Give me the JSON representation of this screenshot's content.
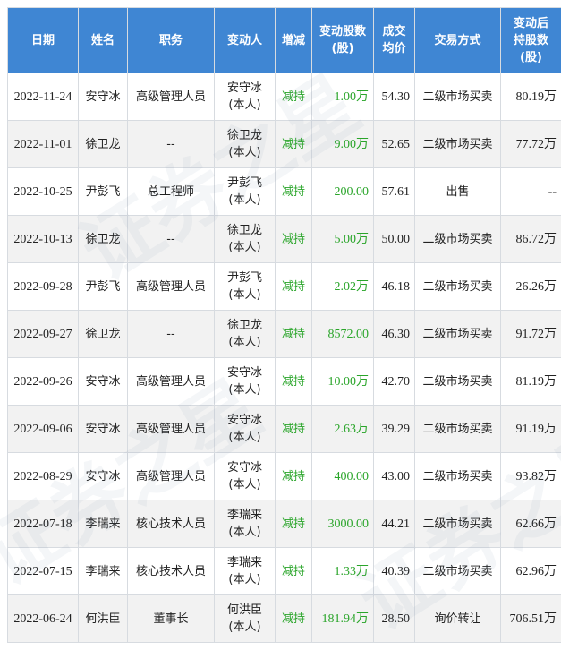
{
  "headers": [
    "日期",
    "姓名",
    "职务",
    "变动人",
    "增减",
    "变动股数\n(股)",
    "成交\n均价",
    "交易方式",
    "变动后\n持股数\n(股)"
  ],
  "rows": [
    {
      "date": "2022-11-24",
      "name": "安守冰",
      "title": "高级管理人员",
      "changer": "安守冰\n(本人)",
      "direction": "减持",
      "shares": "1.00万",
      "price": "54.30",
      "method": "二级市场买卖",
      "after": "80.19万"
    },
    {
      "date": "2022-11-01",
      "name": "徐卫龙",
      "title": "--",
      "changer": "徐卫龙\n(本人)",
      "direction": "减持",
      "shares": "9.00万",
      "price": "52.65",
      "method": "二级市场买卖",
      "after": "77.72万"
    },
    {
      "date": "2022-10-25",
      "name": "尹彭飞",
      "title": "总工程师",
      "changer": "尹彭飞\n(本人)",
      "direction": "减持",
      "shares": "200.00",
      "price": "57.61",
      "method": "出售",
      "after": "--"
    },
    {
      "date": "2022-10-13",
      "name": "徐卫龙",
      "title": "--",
      "changer": "徐卫龙\n(本人)",
      "direction": "减持",
      "shares": "5.00万",
      "price": "50.00",
      "method": "二级市场买卖",
      "after": "86.72万"
    },
    {
      "date": "2022-09-28",
      "name": "尹彭飞",
      "title": "高级管理人员",
      "changer": "尹彭飞\n(本人)",
      "direction": "减持",
      "shares": "2.02万",
      "price": "46.18",
      "method": "二级市场买卖",
      "after": "26.26万"
    },
    {
      "date": "2022-09-27",
      "name": "徐卫龙",
      "title": "--",
      "changer": "徐卫龙\n(本人)",
      "direction": "减持",
      "shares": "8572.00",
      "price": "46.30",
      "method": "二级市场买卖",
      "after": "91.72万"
    },
    {
      "date": "2022-09-26",
      "name": "安守冰",
      "title": "高级管理人员",
      "changer": "安守冰\n(本人)",
      "direction": "减持",
      "shares": "10.00万",
      "price": "42.70",
      "method": "二级市场买卖",
      "after": "81.19万"
    },
    {
      "date": "2022-09-06",
      "name": "安守冰",
      "title": "高级管理人员",
      "changer": "安守冰\n(本人)",
      "direction": "减持",
      "shares": "2.63万",
      "price": "39.29",
      "method": "二级市场买卖",
      "after": "91.19万"
    },
    {
      "date": "2022-08-29",
      "name": "安守冰",
      "title": "高级管理人员",
      "changer": "安守冰\n(本人)",
      "direction": "减持",
      "shares": "400.00",
      "price": "43.00",
      "method": "二级市场买卖",
      "after": "93.82万"
    },
    {
      "date": "2022-07-18",
      "name": "李瑞来",
      "title": "核心技术人员",
      "changer": "李瑞来\n(本人)",
      "direction": "减持",
      "shares": "3000.00",
      "price": "44.21",
      "method": "二级市场买卖",
      "after": "62.66万"
    },
    {
      "date": "2022-07-15",
      "name": "李瑞来",
      "title": "核心技术人员",
      "changer": "李瑞来\n(本人)",
      "direction": "减持",
      "shares": "1.33万",
      "price": "40.39",
      "method": "二级市场买卖",
      "after": "62.96万"
    },
    {
      "date": "2022-06-24",
      "name": "何洪臣",
      "title": "董事长",
      "changer": "何洪臣\n(本人)",
      "direction": "减持",
      "shares": "181.94万",
      "price": "28.50",
      "method": "询价转让",
      "after": "706.51万"
    }
  ],
  "watermark": "证券之星",
  "colors": {
    "header_bg": "#3f86d3",
    "decrease": "#2aa52a",
    "row_alt": "#f2f2f2"
  }
}
